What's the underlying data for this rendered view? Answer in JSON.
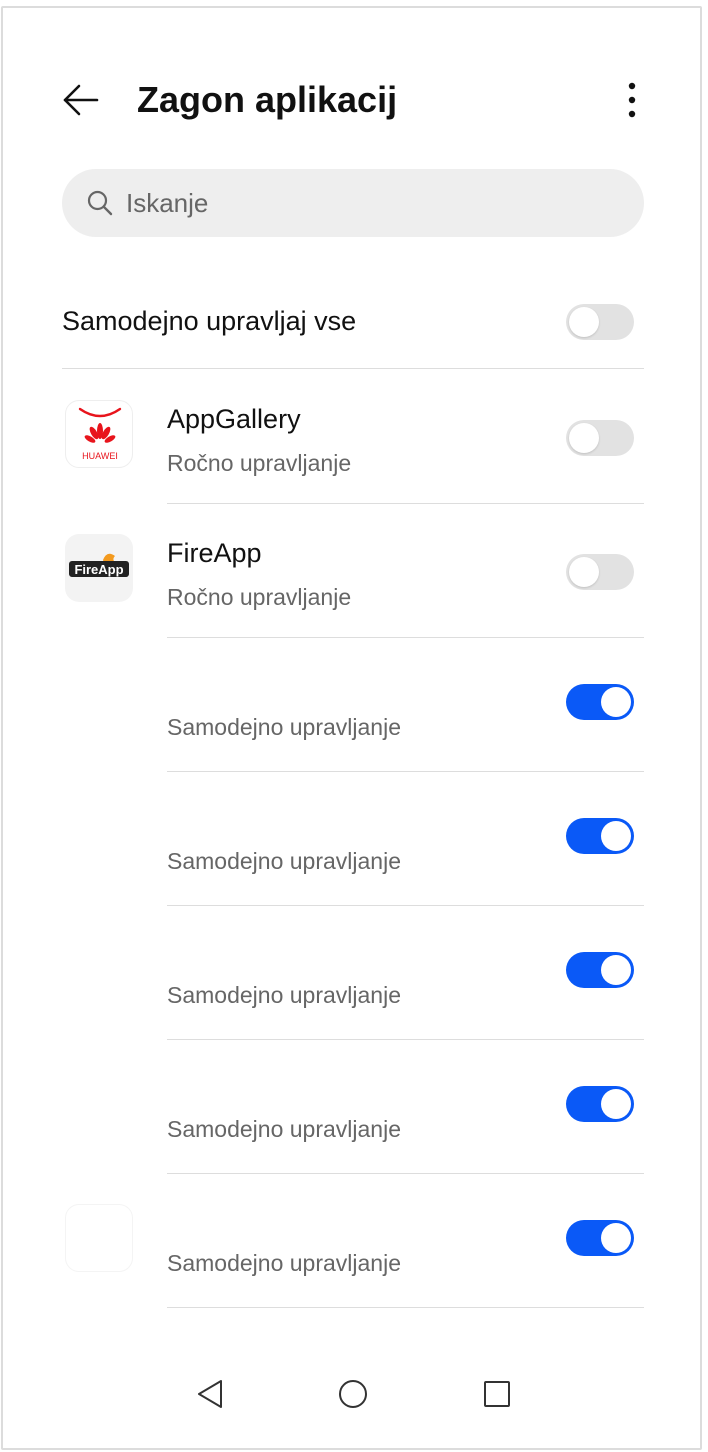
{
  "header": {
    "title": "Zagon aplikacij",
    "back_icon": "arrow-left-icon",
    "more_icon": "more-vertical-icon"
  },
  "search": {
    "placeholder": "Iskanje",
    "icon": "search-icon"
  },
  "auto_all": {
    "label": "Samodejno upravljaj vse",
    "enabled": false
  },
  "apps": [
    {
      "name": "AppGallery",
      "status": "Ročno upravljanje",
      "enabled": false,
      "icon": "appgallery-icon",
      "icon_text": "HUAWEI"
    },
    {
      "name": "FireApp",
      "status": "Ročno upravljanje",
      "enabled": false,
      "icon": "fireapp-icon",
      "icon_text": "FireApp"
    },
    {
      "name": "",
      "status": "Samodejno upravljanje",
      "enabled": true,
      "icon": "app-icon"
    },
    {
      "name": "",
      "status": "Samodejno upravljanje",
      "enabled": true,
      "icon": "app-icon"
    },
    {
      "name": "",
      "status": "Samodejno upravljanje",
      "enabled": true,
      "icon": "app-icon"
    },
    {
      "name": "",
      "status": "Samodejno upravljanje",
      "enabled": true,
      "icon": "app-icon"
    },
    {
      "name": "",
      "status": "Samodejno upravljanje",
      "enabled": true,
      "icon": "app-icon"
    }
  ],
  "navbar": {
    "back_icon": "nav-back-triangle-icon",
    "home_icon": "nav-home-circle-icon",
    "recents_icon": "nav-recents-square-icon"
  },
  "colors": {
    "toggle_on": "#0a59f7",
    "toggle_off": "#e2e2e2",
    "huawei_red": "#e8141c"
  }
}
